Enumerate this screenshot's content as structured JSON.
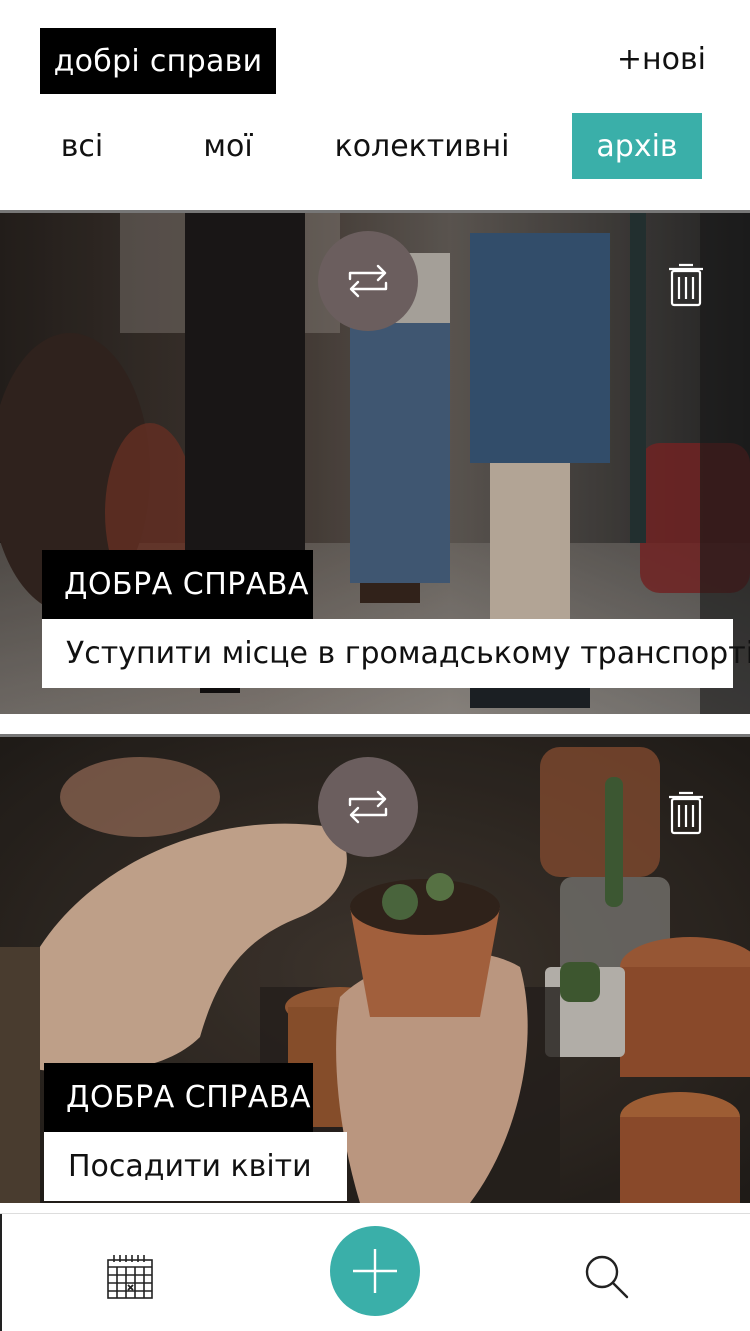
{
  "header": {
    "app_title": "добрі справи",
    "new_label": "+нові"
  },
  "tabs": [
    {
      "label": "всі",
      "active": false
    },
    {
      "label": "мої",
      "active": false
    },
    {
      "label": "колективні",
      "active": false
    },
    {
      "label": "архів",
      "active": true
    }
  ],
  "cards": [
    {
      "tag": "ДОБРА СПРАВА",
      "text": "Уступити місце в громадському транспорті",
      "image": "bus-passengers-photo"
    },
    {
      "tag": "ДОБРА СПРАВА",
      "text": "Посадити квіти",
      "image": "cactus-pot-photo"
    }
  ],
  "icons": {
    "swap": "repeat-arrows-icon",
    "trash": "trash-icon",
    "calendar": "calendar-icon",
    "add": "plus-icon",
    "search": "search-icon"
  },
  "colors": {
    "accent": "#3aafa9",
    "title_bg": "#000000",
    "swap_button": "#6b5e5e"
  }
}
